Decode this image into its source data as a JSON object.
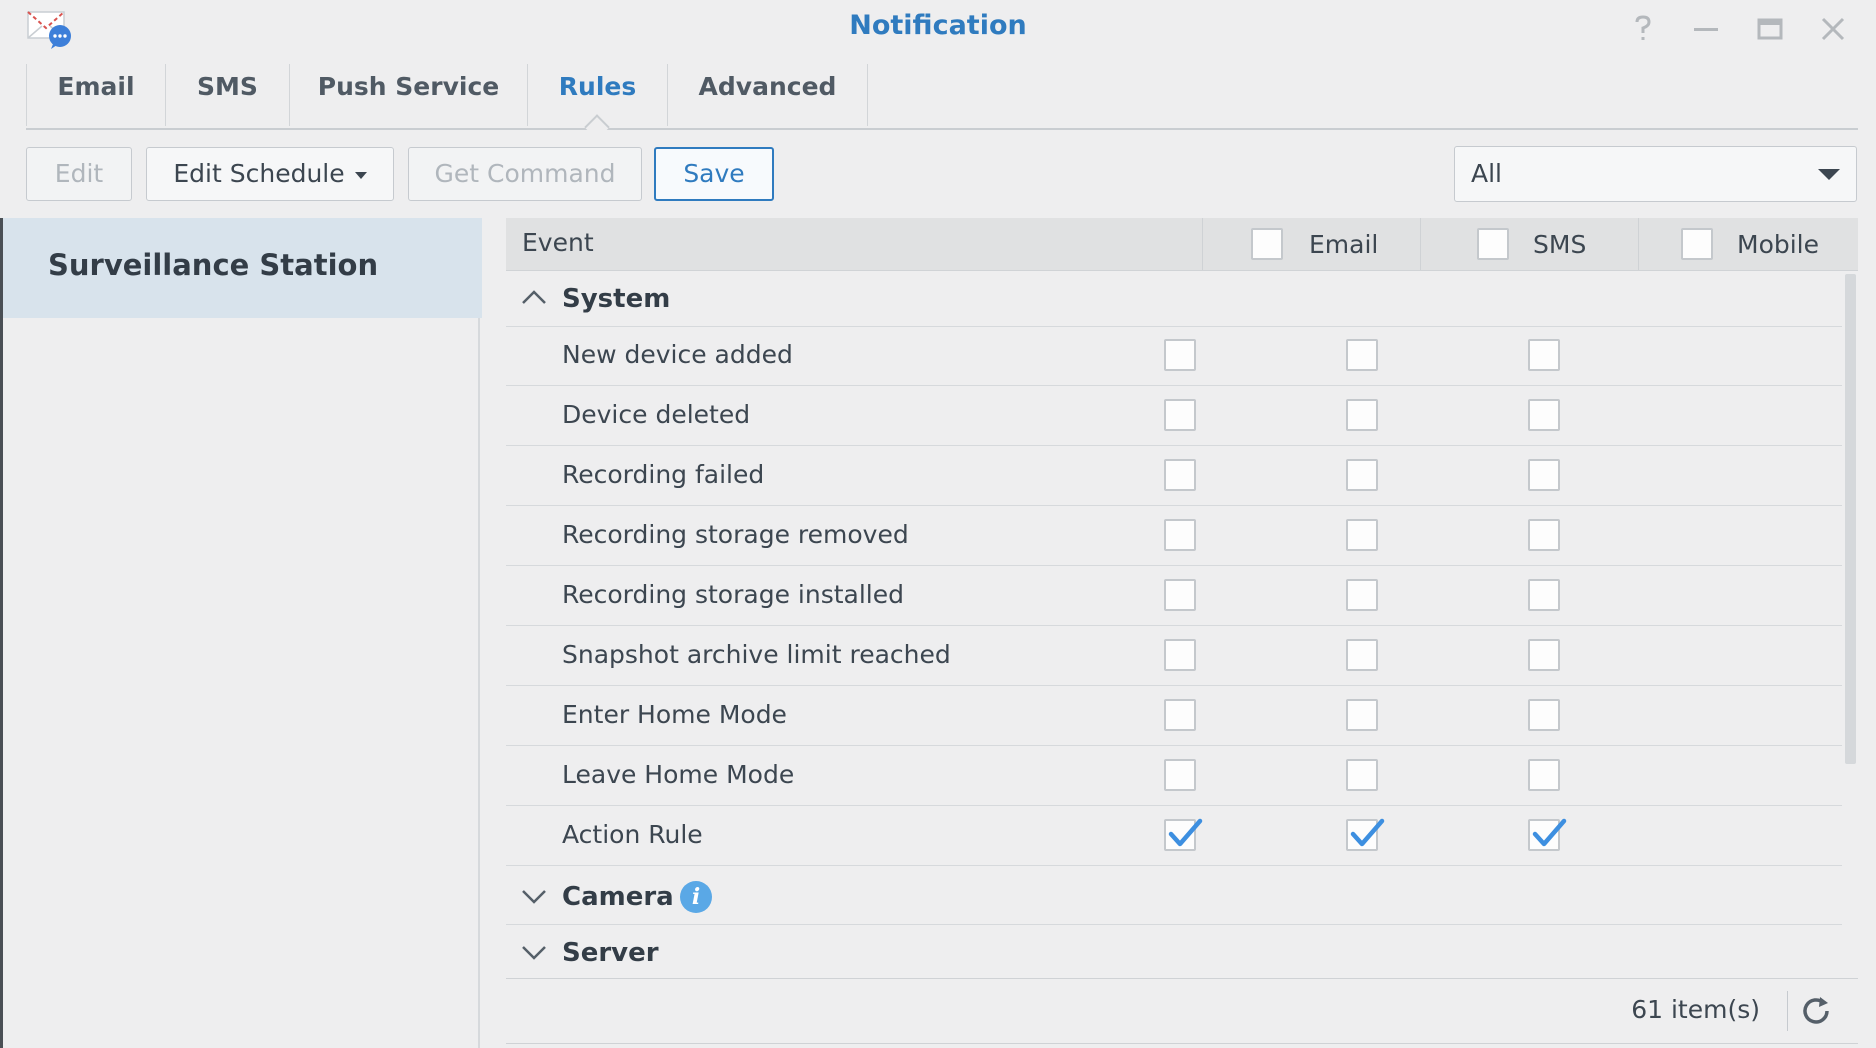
{
  "window": {
    "title": "Notification",
    "app_icon": "notification-app-icon",
    "controls": [
      "help-icon",
      "minimize-icon",
      "maximize-icon",
      "close-icon"
    ]
  },
  "tabs": [
    {
      "label": "Email",
      "active": false
    },
    {
      "label": "SMS",
      "active": false
    },
    {
      "label": "Push Service",
      "active": false
    },
    {
      "label": "Rules",
      "active": true
    },
    {
      "label": "Advanced",
      "active": false
    }
  ],
  "toolbar": {
    "edit_label": "Edit",
    "edit_schedule_label": "Edit Schedule",
    "get_command_label": "Get Command",
    "save_label": "Save",
    "filter_value": "All"
  },
  "sidebar": {
    "items": [
      {
        "label": "Surveillance Station",
        "selected": true
      }
    ]
  },
  "grid": {
    "columns": {
      "event": "Event",
      "email": "Email",
      "sms": "SMS",
      "mobile": "Mobile"
    },
    "groups": [
      {
        "label": "System",
        "expanded": true,
        "rows": [
          {
            "label": "New device added",
            "email": false,
            "sms": false,
            "mobile": false
          },
          {
            "label": "Device deleted",
            "email": false,
            "sms": false,
            "mobile": false
          },
          {
            "label": "Recording failed",
            "email": false,
            "sms": false,
            "mobile": false
          },
          {
            "label": "Recording storage removed",
            "email": false,
            "sms": false,
            "mobile": false
          },
          {
            "label": "Recording storage installed",
            "email": false,
            "sms": false,
            "mobile": false
          },
          {
            "label": "Snapshot archive limit reached",
            "email": false,
            "sms": false,
            "mobile": false
          },
          {
            "label": "Enter Home Mode",
            "email": false,
            "sms": false,
            "mobile": false
          },
          {
            "label": "Leave Home Mode",
            "email": false,
            "sms": false,
            "mobile": false
          },
          {
            "label": "Action Rule",
            "email": true,
            "sms": true,
            "mobile": true
          }
        ]
      },
      {
        "label": "Camera",
        "expanded": false,
        "info_icon": "info-icon"
      },
      {
        "label": "Server",
        "expanded": false
      }
    ],
    "footer": {
      "count": "61 item(s)",
      "refresh_icon": "refresh-icon"
    }
  },
  "colors": {
    "accent": "#2f7bbf",
    "check": "#3d8fe0",
    "selected_bg": "#d8e3ec"
  }
}
